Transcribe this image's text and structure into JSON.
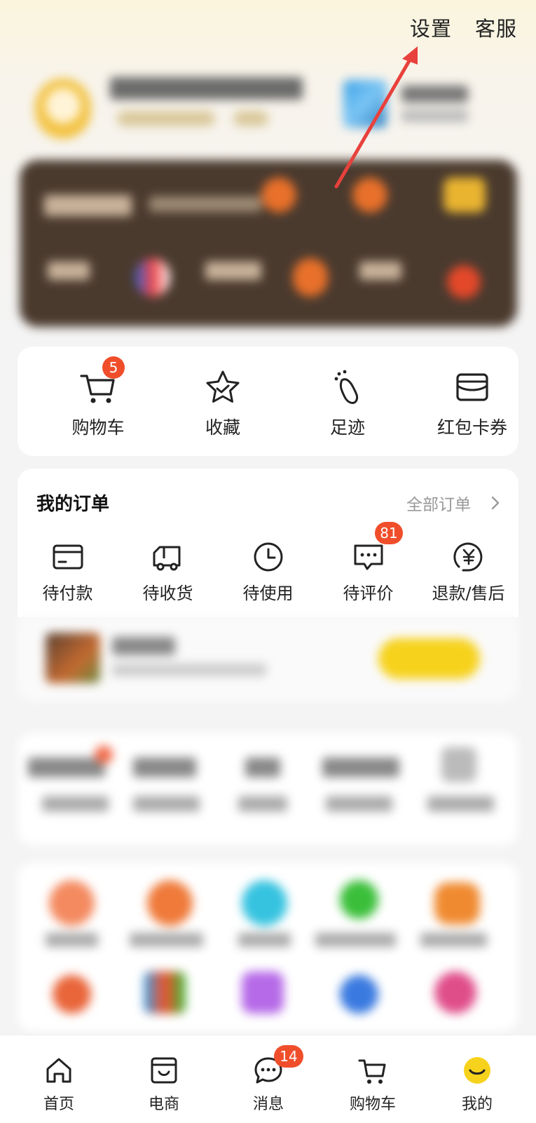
{
  "header": {
    "settings_label": "设置",
    "service_label": "客服"
  },
  "quick_actions": [
    {
      "label": "购物车",
      "icon": "cart-icon",
      "badge": "5"
    },
    {
      "label": "收藏",
      "icon": "star-icon"
    },
    {
      "label": "足迹",
      "icon": "footprint-icon"
    },
    {
      "label": "红包卡券",
      "icon": "wallet-icon"
    }
  ],
  "orders": {
    "title": "我的订单",
    "all_label": "全部订单",
    "items": [
      {
        "label": "待付款",
        "icon": "card-icon"
      },
      {
        "label": "待收货",
        "icon": "truck-icon"
      },
      {
        "label": "待使用",
        "icon": "clock-icon"
      },
      {
        "label": "待评价",
        "icon": "comment-icon",
        "badge": "81"
      },
      {
        "label": "退款/售后",
        "icon": "refund-icon"
      }
    ]
  },
  "tabbar": [
    {
      "label": "首页",
      "icon": "home-icon"
    },
    {
      "label": "电商",
      "icon": "shop-box-icon"
    },
    {
      "label": "消息",
      "icon": "message-icon",
      "badge": "14"
    },
    {
      "label": "购物车",
      "icon": "cart-icon"
    },
    {
      "label": "我的",
      "icon": "smiley-icon"
    }
  ],
  "colors": {
    "badge": "#f04e2b",
    "accent_yellow": "#f7d21c",
    "annotation_arrow": "#e8413c"
  }
}
